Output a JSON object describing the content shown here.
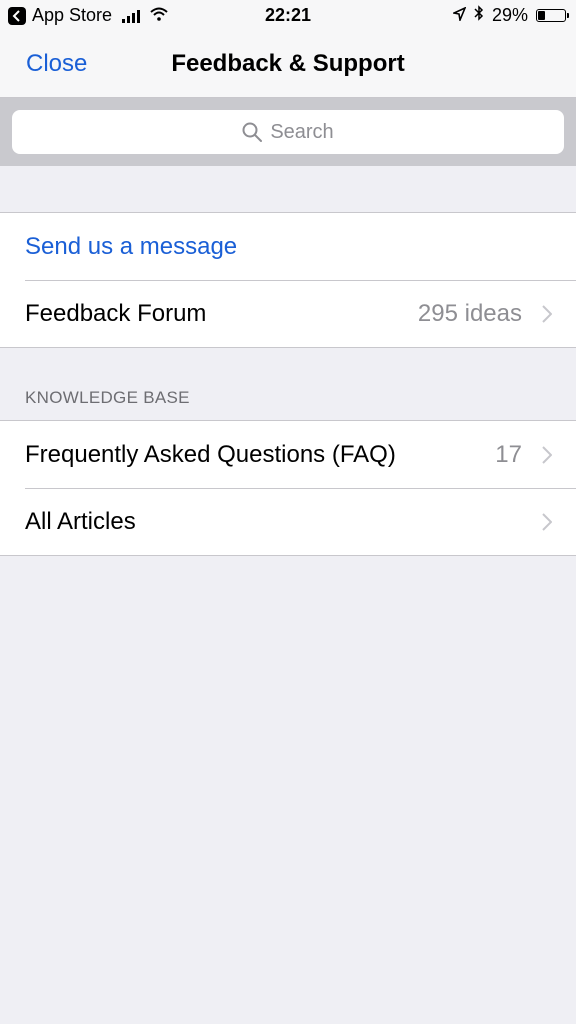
{
  "status_bar": {
    "back_app": "App Store",
    "time": "22:21",
    "battery_percent": "29%",
    "battery_level": 0.29,
    "icons": [
      "back-arrow-icon",
      "signal-icon",
      "wifi-icon",
      "location-arrow-icon",
      "bluetooth-icon",
      "battery-icon"
    ]
  },
  "nav": {
    "close_label": "Close",
    "title": "Feedback & Support"
  },
  "search": {
    "placeholder": "Search"
  },
  "group1": {
    "send_message": "Send us a message",
    "feedback_forum": "Feedback Forum",
    "feedback_forum_detail": "295 ideas"
  },
  "knowledge_base": {
    "header": "KNOWLEDGE BASE",
    "faq": "Frequently Asked Questions (FAQ)",
    "faq_count": "17",
    "all_articles": "All Articles"
  },
  "colors": {
    "accent": "#1a5fd6",
    "background": "#efeff4",
    "secondary_text": "#8e8e93"
  }
}
